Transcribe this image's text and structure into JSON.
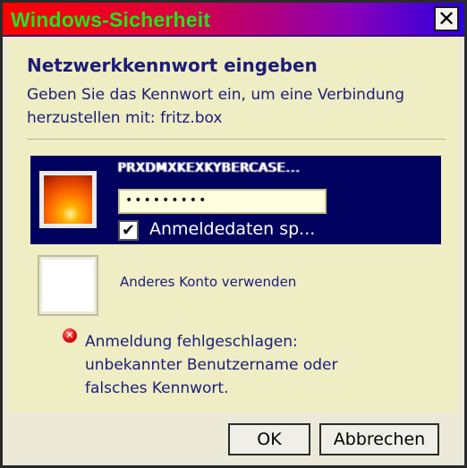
{
  "window": {
    "title": "Windows-Sicherheit",
    "close_glyph": "✕"
  },
  "dialog": {
    "heading": "Netzwerkkennwort eingeben",
    "description": "Geben Sie das Kennwort ein, um eine Verbindung herzustellen mit: fritz.box"
  },
  "credential": {
    "username": "PRXDMXKEXKYBERCASE...",
    "password_masked": "•••••••••",
    "remember_checked": true,
    "remember_glyph": "✔",
    "remember_label": "Anmeldedaten sp...",
    "avatar": "flower-avatar"
  },
  "other_account": {
    "label": "Anderes Konto verwenden"
  },
  "error": {
    "icon": "error-icon",
    "glyph": "✕",
    "message": "Anmeldung fehlgeschlagen: unbekannter Benutzername oder falsches Kennwort."
  },
  "buttons": {
    "ok": "OK",
    "cancel": "Abbrechen"
  },
  "colors": {
    "title_text": "#1ee61e",
    "selected_tile": "#00005e",
    "content_bg": "#efedc4",
    "text_blue": "#1c1c78"
  }
}
